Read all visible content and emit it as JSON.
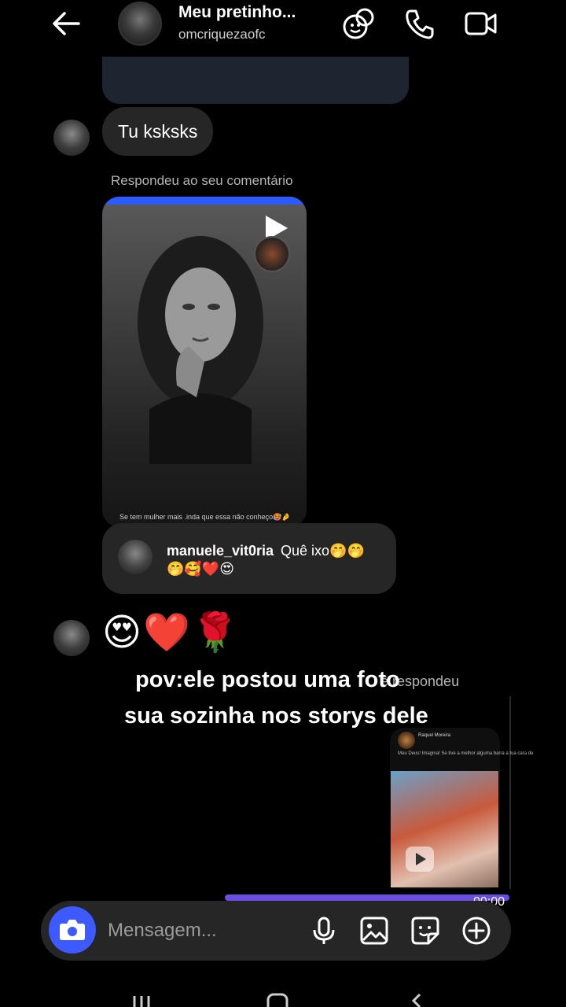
{
  "header": {
    "contact_name": "Meu pretinho...",
    "username": "omcriquezaofc",
    "icons": [
      "back-arrow-icon",
      "effects-icon",
      "phone-icon",
      "video-icon"
    ]
  },
  "messages": {
    "received_text": "Tu ksksks",
    "reply_note": "Respondeu ao seu comentário",
    "story_caption": "Se tem mulher mais .inda que essa não conheço🥵🤌",
    "comment": {
      "username": "manuele_vit0ria",
      "text": "Quê ixo🤭🤭",
      "text_line2": "🤭🥰❤️😍"
    },
    "emoji_message": "😍❤️🌹",
    "you_replied": "ê respondeu",
    "replied_story": {
      "name": "Raquel Moreira",
      "text": "Meu Deus! Imagina! Se tive a melhor alguma barra a tua cara de"
    }
  },
  "overlay": {
    "line1": "pov:ele postou uma foto",
    "line2": "sua sozinha nos storys dele"
  },
  "audio": {
    "time": "00:00",
    "progress_fraction": 1.0
  },
  "composer": {
    "placeholder": "Mensagem...",
    "icons": [
      "camera-icon",
      "microphone-icon",
      "gallery-icon",
      "sticker-icon",
      "add-icon"
    ]
  },
  "colors": {
    "accent": "#3d5afe",
    "progress": "#6a4de3",
    "bubble": "#262626",
    "background": "#000000"
  }
}
